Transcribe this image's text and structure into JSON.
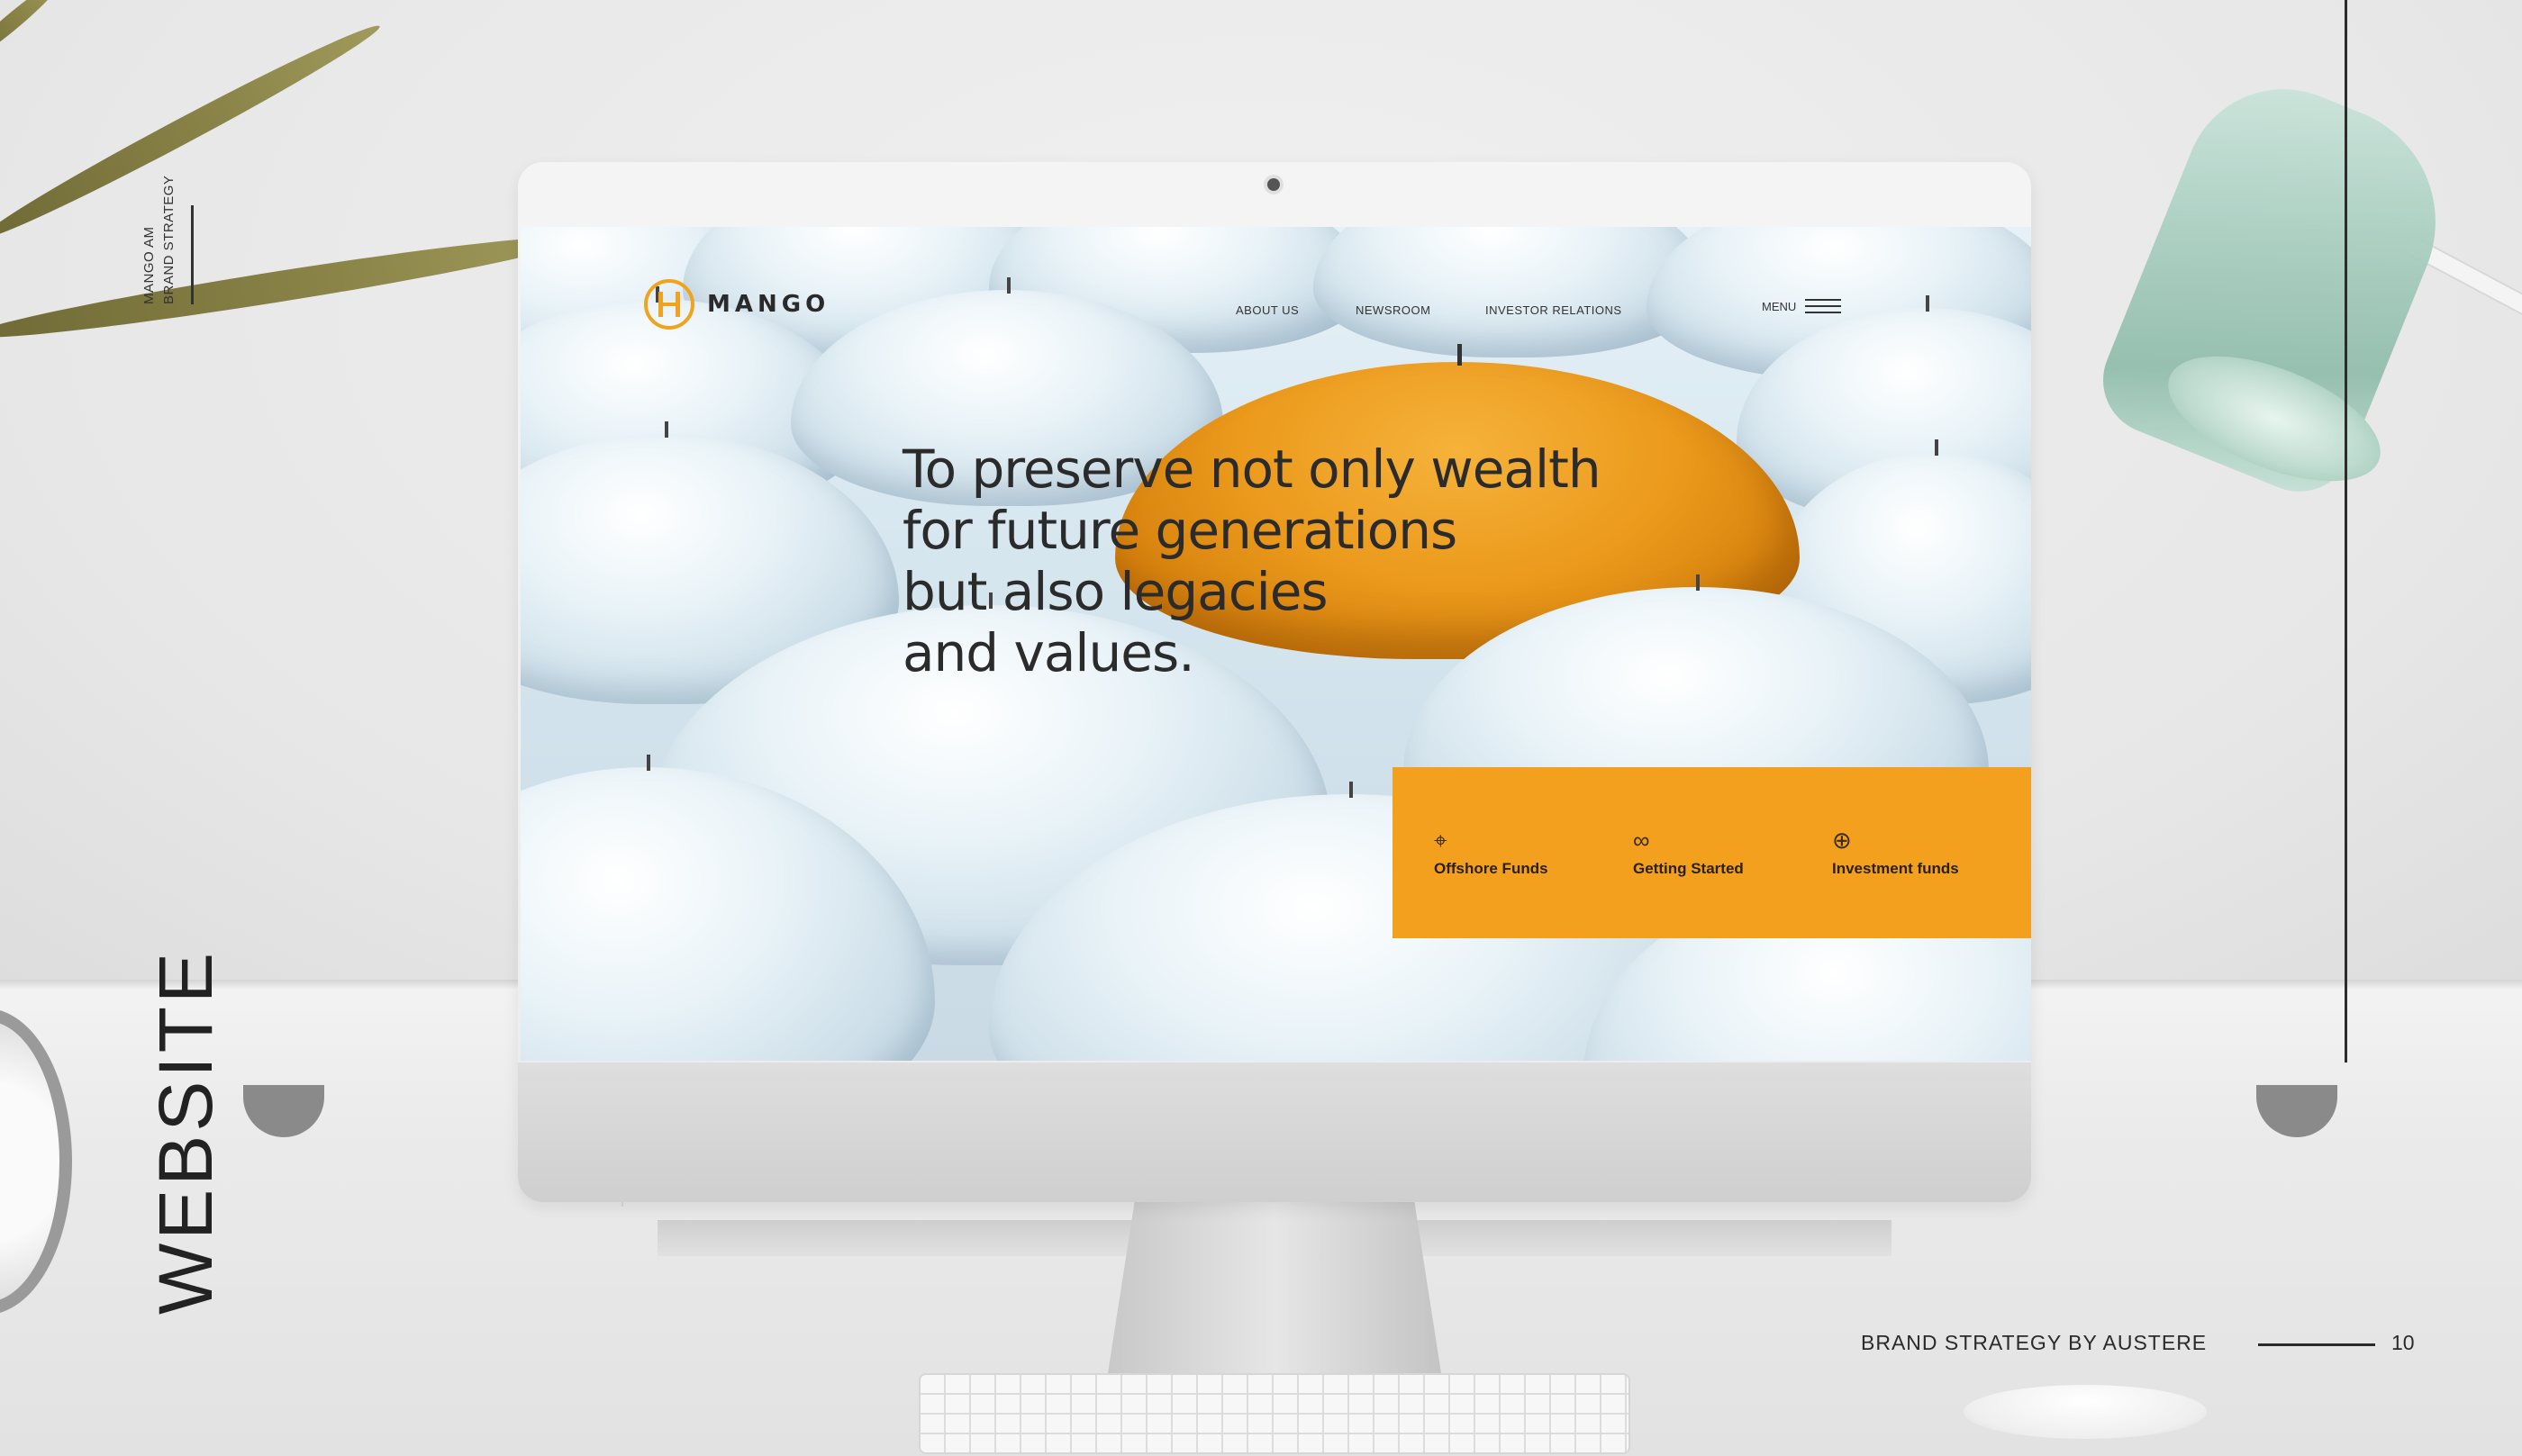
{
  "page": {
    "side_brand_line1": "MANGO AM",
    "side_brand_line2": "BRAND STRATEGY",
    "section_title": "WEBSITE",
    "footer_text": "BRAND STRATEGY BY AUSTERE",
    "page_number": "10"
  },
  "site": {
    "logo_text": "MANGO",
    "nav": [
      {
        "label": "ABOUT US"
      },
      {
        "label": "NEWSROOM"
      },
      {
        "label": "INVESTOR RELATIONS"
      }
    ],
    "menu_label": "MENU",
    "hero_lines": [
      "To preserve not only wealth",
      "for future generations",
      "but also legacies",
      "and values."
    ],
    "features": [
      {
        "label": "Offshore Funds",
        "icon": "target-icon"
      },
      {
        "label": "Getting Started",
        "icon": "handshake-icon"
      },
      {
        "label": "Investment funds",
        "icon": "globe-icon"
      }
    ]
  },
  "colors": {
    "accent_orange": "#f4a01f",
    "text_dark": "#2b2b2b"
  }
}
